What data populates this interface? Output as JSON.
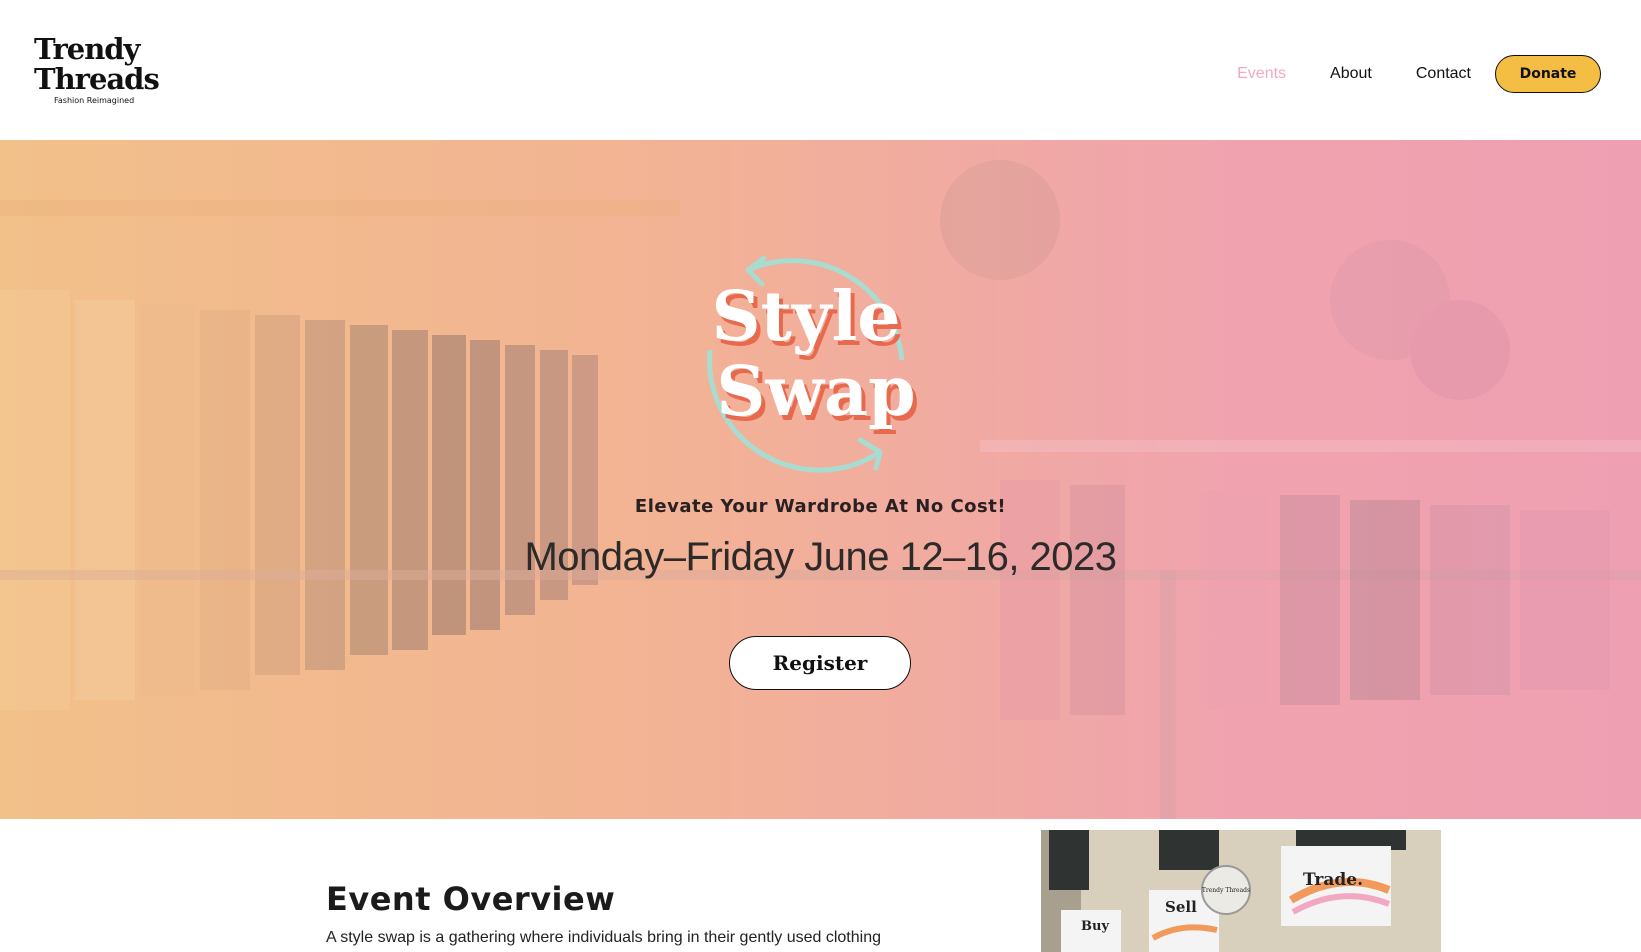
{
  "brand": {
    "line1": "Trendy",
    "line2": "Threads",
    "tagline": "Fashion Reimagined"
  },
  "nav": {
    "items": [
      {
        "label": "Events",
        "active": true
      },
      {
        "label": "About",
        "active": false
      },
      {
        "label": "Contact",
        "active": false
      }
    ],
    "donate_label": "Donate"
  },
  "hero": {
    "badge": {
      "line1": "Style",
      "line2": "Swap"
    },
    "tagline": "Elevate Your Wardrobe At No Cost!",
    "dates": "Monday–Friday June 12–16, 2023",
    "register_label": "Register"
  },
  "overview": {
    "title": "Event Overview",
    "text": "A style swap is a gathering where individuals bring in their gently used clothing"
  },
  "storefront": {
    "signs": [
      "Buy",
      "Sell",
      "Trade.",
      "Trendy Threads"
    ]
  },
  "colors": {
    "accent_pink": "#f2a7c3",
    "donate_yellow": "#f4bd44",
    "badge_mint": "#a9dcd0",
    "badge_coral": "#e86a4e"
  }
}
